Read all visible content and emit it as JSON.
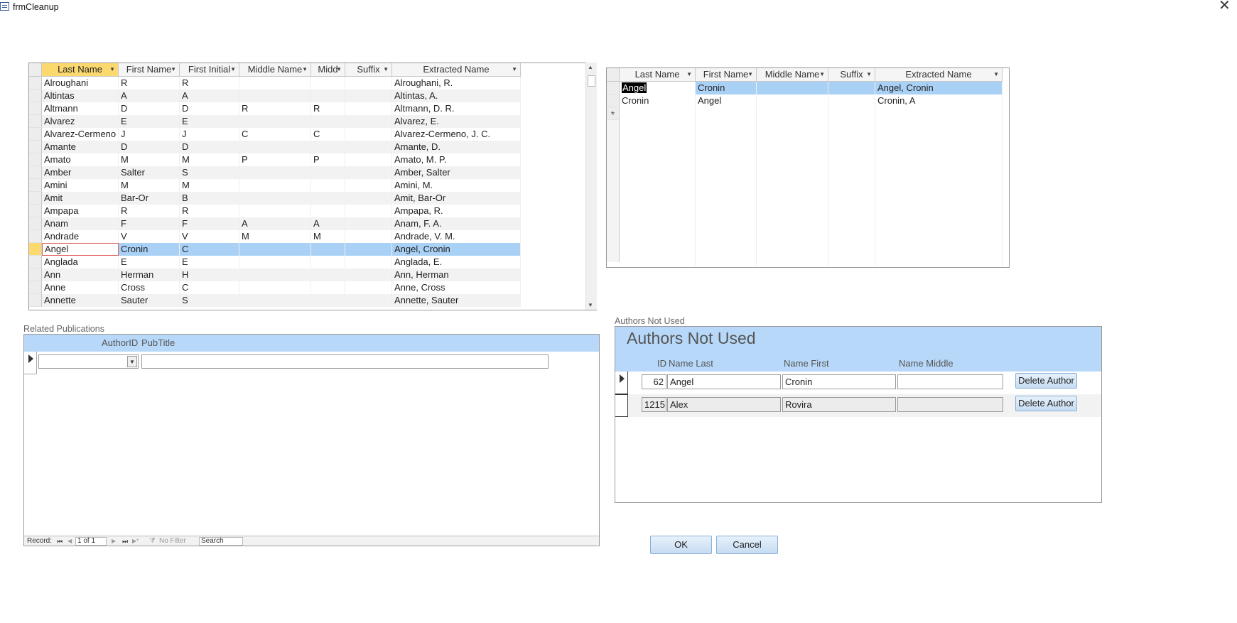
{
  "window": {
    "title": "frmCleanup",
    "close_glyph": "✕",
    "icon": "form-icon"
  },
  "grid1": {
    "columns": [
      "Last Name",
      "First Name",
      "First Initial",
      "Middle Name",
      "Midd",
      "Suffix",
      "Extracted Name"
    ],
    "sorted_column": "Last Name",
    "rows": [
      [
        "Alroughani",
        "R",
        "R",
        "",
        "",
        "",
        "Alroughani, R."
      ],
      [
        "Altintas",
        "A",
        "A",
        "",
        "",
        "",
        "Altintas, A."
      ],
      [
        "Altmann",
        "D",
        "D",
        "R",
        "R",
        "",
        "Altmann, D. R."
      ],
      [
        "Alvarez",
        "E",
        "E",
        "",
        "",
        "",
        "Alvarez, E."
      ],
      [
        "Alvarez-Cermeno",
        "J",
        "J",
        "C",
        "C",
        "",
        "Alvarez-Cermeno, J. C."
      ],
      [
        "Amante",
        "D",
        "D",
        "",
        "",
        "",
        "Amante, D."
      ],
      [
        "Amato",
        "M",
        "M",
        "P",
        "P",
        "",
        "Amato, M. P."
      ],
      [
        "Amber",
        "Salter",
        "S",
        "",
        "",
        "",
        "Amber, Salter"
      ],
      [
        "Amini",
        "M",
        "M",
        "",
        "",
        "",
        "Amini, M."
      ],
      [
        "Amit",
        "Bar-Or",
        "B",
        "",
        "",
        "",
        "Amit, Bar-Or"
      ],
      [
        "Ampapa",
        "R",
        "R",
        "",
        "",
        "",
        "Ampapa, R."
      ],
      [
        "Anam",
        "F",
        "F",
        "A",
        "A",
        "",
        "Anam, F. A."
      ],
      [
        "Andrade",
        "V",
        "V",
        "M",
        "M",
        "",
        "Andrade, V. M."
      ],
      [
        "Angel",
        "Cronin",
        "C",
        "",
        "",
        "",
        "Angel, Cronin"
      ],
      [
        "Anglada",
        "E",
        "E",
        "",
        "",
        "",
        "Anglada, E."
      ],
      [
        "Ann",
        "Herman",
        "H",
        "",
        "",
        "",
        "Ann, Herman"
      ],
      [
        "Anne",
        "Cross",
        "C",
        "",
        "",
        "",
        "Anne, Cross"
      ],
      [
        "Annette",
        "Sauter",
        "S",
        "",
        "",
        "",
        "Annette, Sauter"
      ]
    ],
    "current_row": 13
  },
  "grid2": {
    "columns": [
      "Last Name",
      "First Name",
      "Middle Name",
      "Suffix",
      "Extracted Name"
    ],
    "rows": [
      [
        "Angel",
        "Cronin",
        "",
        "",
        "Angel, Cronin"
      ],
      [
        "Cronin",
        "Angel",
        "",
        "",
        "Cronin, A"
      ]
    ],
    "new_record_glyph": "*"
  },
  "related": {
    "section_label": "Related Publications",
    "header_authorid": "AuthorID",
    "header_pubtitle": "PubTitle",
    "authorid_value": "",
    "pubtitle_value": ""
  },
  "navbar": {
    "record_label": "Record:",
    "first_glyph": "⏮",
    "prev_glyph": "◀",
    "position": "1 of 1",
    "next_glyph": "▶",
    "last_glyph": "⏭",
    "new_glyph": "▶*",
    "filter_label": "No Filter",
    "search_label": "Search"
  },
  "authors_not_used": {
    "section_label": "Authors Not Used",
    "title": "Authors Not Used",
    "col_id": "ID",
    "col_last": "Name Last",
    "col_first": "Name First",
    "col_middle": "Name Middle",
    "delete_label": "Delete Author",
    "rows": [
      {
        "id": "62",
        "last": "Angel",
        "first": "Cronin",
        "middle": ""
      },
      {
        "id": "1215",
        "last": "Alex",
        "first": "Rovira",
        "middle": ""
      }
    ]
  },
  "buttons": {
    "ok": "OK",
    "cancel": "Cancel"
  },
  "colors": {
    "accent_blue": "#b7d8f8",
    "selection": "#a9d1f6",
    "sort_header": "#fcd96e"
  }
}
